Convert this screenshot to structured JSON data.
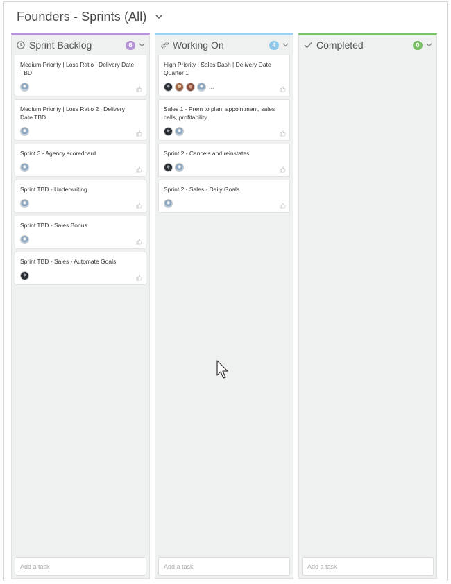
{
  "board": {
    "title": "Founders - Sprints (All)"
  },
  "columns": [
    {
      "id": "backlog",
      "title": "Sprint Backlog",
      "icon": "clock-icon",
      "count": "6",
      "count_color": "#b794d6",
      "accent": "#b794d6",
      "add_placeholder": "Add a task",
      "cards": [
        {
          "title": "Medium Priority | Loss Ratio | Delivery Date TBD"
        },
        {
          "title": "Medium Priority | Loss Ratio 2 | Delivery Date TBD"
        },
        {
          "title": "Sprint 3 - Agency scoredcard"
        },
        {
          "title": "Sprint TBD - Underwriting"
        },
        {
          "title": "Sprint TBD - Sales Bonus"
        },
        {
          "title": "Sprint TBD - Sales - Automate Goals"
        }
      ]
    },
    {
      "id": "working",
      "title": "Working On",
      "icon": "gears-icon",
      "count": "4",
      "count_color": "#8ec9ea",
      "accent": "#9cd0ee",
      "add_placeholder": "Add a task",
      "cards": [
        {
          "title": "High Priority | Sales Dash | Delivery Date Quarter 1",
          "more": "..."
        },
        {
          "title": "Sales 1 - Prem to plan, appointment, sales calls, profitability"
        },
        {
          "title": "Sprint 2 - Cancels and reinstates"
        },
        {
          "title": "Sprint 2 - Sales - Daily Goals"
        }
      ]
    },
    {
      "id": "completed",
      "title": "Completed",
      "icon": "checkmark-icon",
      "count": "0",
      "count_color": "#7cc16a",
      "accent": "#7cc16a",
      "add_placeholder": "Add a task",
      "cards": []
    }
  ]
}
